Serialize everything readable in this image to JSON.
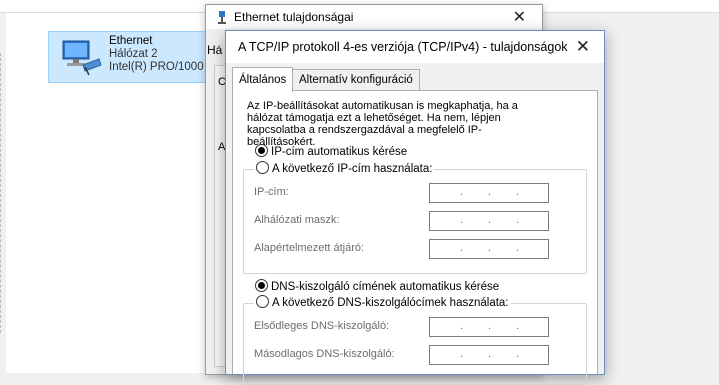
{
  "network_connections": {
    "adapter": {
      "name": "Ethernet",
      "network": "Hálózat 2",
      "device": "Intel(R) PRO/1000"
    }
  },
  "ethernet_window": {
    "title": "Ethernet tulajdonságai",
    "close_glyph": "✕",
    "tab_fragment": "Há",
    "side_c": "C",
    "side_a": "A"
  },
  "tcpip_dialog": {
    "title": "A TCP/IP protokoll 4-es verziója (TCP/IPv4) - tulajdonságok",
    "close_glyph": "✕",
    "tabs": [
      "Általános",
      "Alternatív konfiguráció"
    ],
    "active_tab": "Általános",
    "description": "Az IP-beállításokat automatikusan is megkaphatja, ha a hálózat támogatja ezt a lehetőséget. Ha nem, lépjen kapcsolatba a rendszergazdával a megfelelő IP-beállításokért.",
    "ip_section": {
      "auto_label": "IP-cím automatikus kérése",
      "manual_label": "A következő IP-cím használata:",
      "selected": "auto",
      "fields": [
        {
          "label": "IP-cím:",
          "value": ".   .   ."
        },
        {
          "label": "Alhálózati maszk:",
          "value": ".   .   ."
        },
        {
          "label": "Alapértelmezett átjáró:",
          "value": ".   .   ."
        }
      ]
    },
    "dns_section": {
      "auto_label": "DNS-kiszolgáló címének automatikus kérése",
      "manual_label": "A következő DNS-kiszolgálócímek használata:",
      "selected": "auto",
      "fields": [
        {
          "label": "Elsődleges DNS-kiszolgáló:",
          "value": ".   .   ."
        },
        {
          "label": "Másodlagos DNS-kiszolgáló:",
          "value": ".   .   ."
        }
      ]
    }
  },
  "colors": {
    "selection_bg": "#cce8ff",
    "selection_border": "#99d1ff",
    "dialog_border": "#6e8fbf",
    "disabled_text": "#6d6d6d"
  },
  "icons": [
    "network-adapter-icon",
    "ethernet-properties-icon",
    "close-icon",
    "radio-selected",
    "radio-unselected"
  ]
}
